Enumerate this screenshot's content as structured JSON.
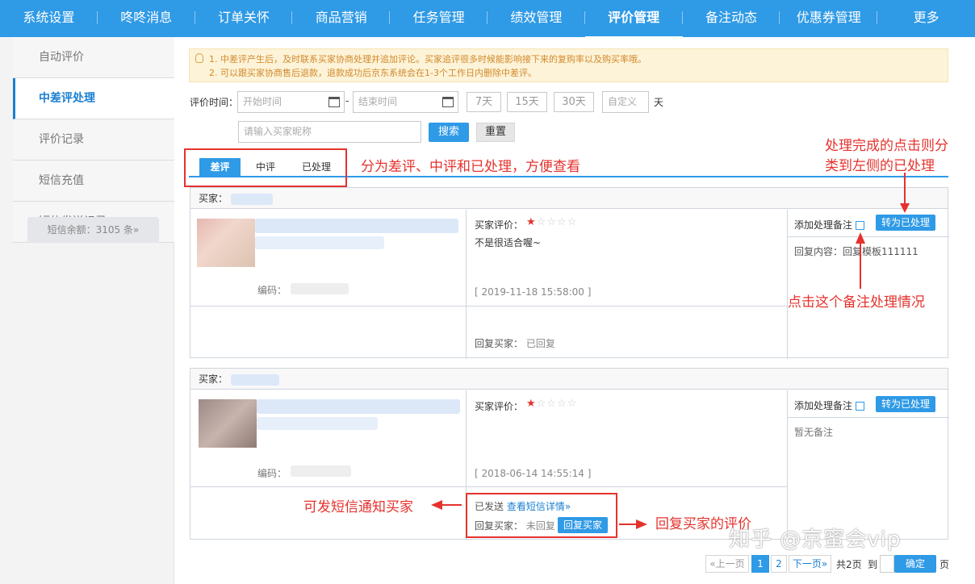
{
  "topnav": [
    "系统设置",
    "咚咚消息",
    "订单关怀",
    "商品营销",
    "任务管理",
    "绩效管理",
    "评价管理",
    "备注动态",
    "优惠券管理",
    "更多"
  ],
  "sidebar": {
    "items": [
      "自动评价",
      "中差评处理",
      "评价记录",
      "短信充值",
      "短信发送记录"
    ],
    "sms_balance": "短信余额：3105 条»"
  },
  "notice": {
    "line1": "1. 中差评产生后，及时联系买家协商处理并追加评论。买家追评很多时候能影响接下来的复购率以及购买率哦。",
    "line2": "2. 可以跟买家协商售后退款，退款成功后京东系统会在1-3个工作日内删除中差评。"
  },
  "filter": {
    "time_label": "评价时间：",
    "start_placeholder": "开始时间",
    "dash": "-",
    "end_placeholder": "结束时间",
    "days": [
      "7天",
      "15天",
      "30天"
    ],
    "custom_placeholder": "自定义",
    "day_unit": "天",
    "buyer_placeholder": "请输入买家昵称",
    "search": "搜索",
    "reset": "重置"
  },
  "tabs": [
    "差评",
    "中评",
    "已处理"
  ],
  "annotations": {
    "tabs_note": "分为差评、中评和已处理，方便查看",
    "done_note_1": "处理完成的点击则分",
    "done_note_2": "类到左侧的已处理",
    "remark_note": "点击这个备注处理情况",
    "sms_note": "可发短信通知买家",
    "reply_note": "回复买家的评价"
  },
  "cards": [
    {
      "buyer_label": "买家：",
      "code_label": "编码：",
      "rating_label": "买家评价：",
      "stars": 1,
      "comment": "不是很适合喔~",
      "time": "[ 2019-11-18 15:58:00 ]",
      "reply_label": "回复买家：",
      "reply_status": "已回复",
      "remark_label": "添加处理备注",
      "mark_button": "转为已处理",
      "remark_content": "回复内容：回复模板111111"
    },
    {
      "buyer_label": "买家：",
      "code_label": "编码：",
      "rating_label": "买家评价：",
      "stars": 1,
      "comment": "",
      "time": "[ 2018-06-14 14:55:14 ]",
      "sms_status": "已发送",
      "sms_link": "查看短信详情»",
      "reply_label": "回复买家：",
      "reply_status": "未回复",
      "reply_button": "回复买家",
      "remark_label": "添加处理备注",
      "mark_button": "转为已处理",
      "remark_content": "暂无备注"
    }
  ],
  "pagination": {
    "prev": "«上一页",
    "pages": [
      "1",
      "2"
    ],
    "next": "下一页»",
    "total": "共2页",
    "goto": "到",
    "confirm": "确定",
    "page_unit": "页"
  },
  "watermark": "知乎 @京蜜会vip",
  "colors": {
    "accent": "#2f9ae6",
    "annotation": "#e5322d",
    "notice_bg": "#fdf3d8",
    "star": "#e5322d"
  }
}
